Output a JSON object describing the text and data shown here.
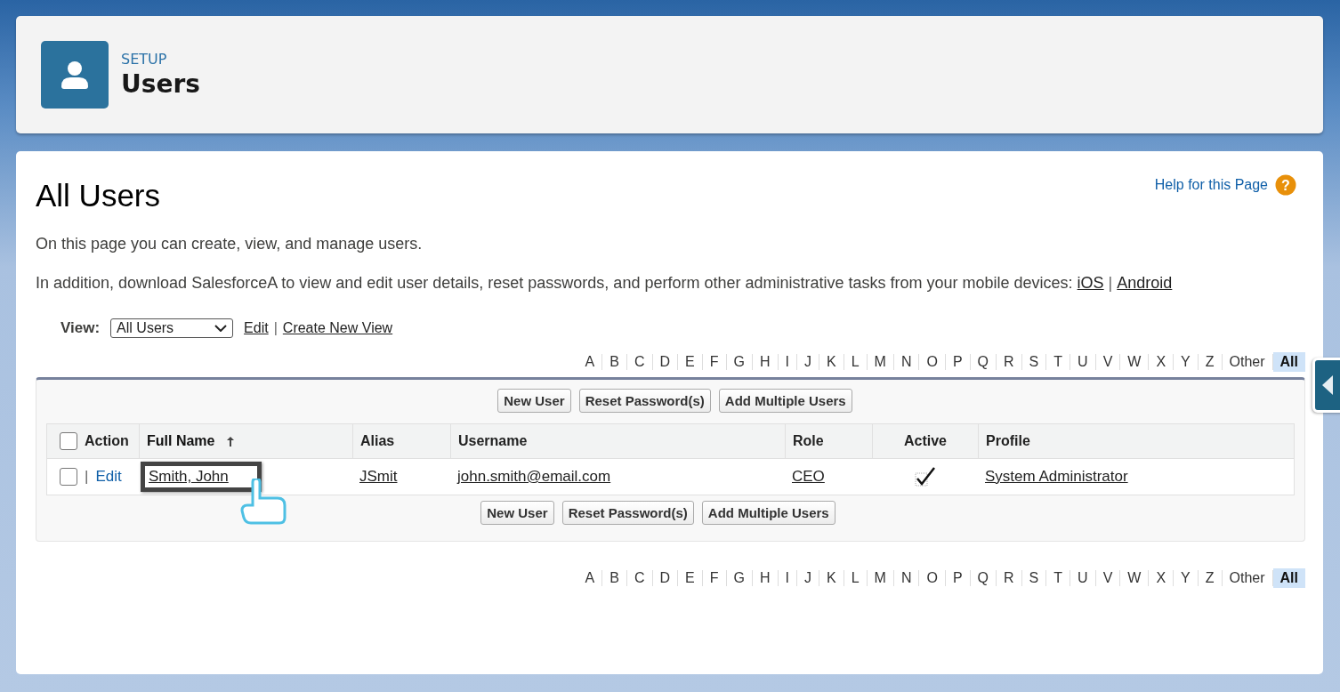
{
  "header": {
    "eyebrow": "SETUP",
    "title": "Users"
  },
  "page": {
    "title": "All Users",
    "help_link": "Help for this Page",
    "help_icon": "?",
    "link_separator": "|",
    "intro": "On this page you can create, view, and manage users.",
    "mobile_text": "In addition, download SalesforceA to view and edit user details, reset passwords, and perform other administrative tasks from your mobile devices:",
    "mobile_links": [
      "iOS",
      "Android"
    ]
  },
  "view": {
    "label": "View:",
    "value": "All Users",
    "links": [
      "Edit",
      "Create New View"
    ],
    "separator": "|"
  },
  "alphabet_top": [
    {
      "label": "A",
      "selected": false
    },
    {
      "label": "B",
      "selected": false
    },
    {
      "label": "C",
      "selected": false
    },
    {
      "label": "D",
      "selected": false
    },
    {
      "label": "E",
      "selected": false
    },
    {
      "label": "F",
      "selected": false
    },
    {
      "label": "G",
      "selected": false
    },
    {
      "label": "H",
      "selected": false
    },
    {
      "label": "I",
      "selected": false
    },
    {
      "label": "J",
      "selected": false
    },
    {
      "label": "K",
      "selected": false
    },
    {
      "label": "L",
      "selected": false
    },
    {
      "label": "M",
      "selected": false
    },
    {
      "label": "N",
      "selected": false
    },
    {
      "label": "O",
      "selected": false
    },
    {
      "label": "P",
      "selected": false
    },
    {
      "label": "Q",
      "selected": false
    },
    {
      "label": "R",
      "selected": false
    },
    {
      "label": "S",
      "selected": false
    },
    {
      "label": "T",
      "selected": false
    },
    {
      "label": "U",
      "selected": false
    },
    {
      "label": "V",
      "selected": false
    },
    {
      "label": "W",
      "selected": false
    },
    {
      "label": "X",
      "selected": false
    },
    {
      "label": "Y",
      "selected": false
    },
    {
      "label": "Z",
      "selected": false
    },
    {
      "label": "Other",
      "selected": false
    },
    {
      "label": "All",
      "selected": true
    }
  ],
  "buttons_top": [
    "New User",
    "Reset Password(s)",
    "Add Multiple Users"
  ],
  "table": {
    "select_all_checked": false,
    "columns": [
      {
        "label": "Action",
        "sorted": false
      },
      {
        "label": "Full Name",
        "sorted": true
      },
      {
        "label": "Alias",
        "sorted": false
      },
      {
        "label": "Username",
        "sorted": false
      },
      {
        "label": "Role",
        "sorted": false
      },
      {
        "label": "Active",
        "sorted": false
      },
      {
        "label": "Profile",
        "sorted": false
      }
    ],
    "rows": [
      {
        "checked": false,
        "separator": "|",
        "action": "Edit",
        "full_name": "Smith, John",
        "highlighted": true,
        "alias": "JSmit",
        "username": "john.smith@email.com",
        "role": "CEO",
        "active": true,
        "profile": "System Administrator"
      }
    ]
  },
  "buttons_bottom": [
    "New User",
    "Reset Password(s)",
    "Add Multiple Users"
  ],
  "alphabet_bottom": [
    {
      "label": "A",
      "selected": false
    },
    {
      "label": "B",
      "selected": false
    },
    {
      "label": "C",
      "selected": false
    },
    {
      "label": "D",
      "selected": false
    },
    {
      "label": "E",
      "selected": false
    },
    {
      "label": "F",
      "selected": false
    },
    {
      "label": "G",
      "selected": false
    },
    {
      "label": "H",
      "selected": false
    },
    {
      "label": "I",
      "selected": false
    },
    {
      "label": "J",
      "selected": false
    },
    {
      "label": "K",
      "selected": false
    },
    {
      "label": "L",
      "selected": false
    },
    {
      "label": "M",
      "selected": false
    },
    {
      "label": "N",
      "selected": false
    },
    {
      "label": "O",
      "selected": false
    },
    {
      "label": "P",
      "selected": false
    },
    {
      "label": "Q",
      "selected": false
    },
    {
      "label": "R",
      "selected": false
    },
    {
      "label": "S",
      "selected": false
    },
    {
      "label": "T",
      "selected": false
    },
    {
      "label": "U",
      "selected": false
    },
    {
      "label": "V",
      "selected": false
    },
    {
      "label": "W",
      "selected": false
    },
    {
      "label": "X",
      "selected": false
    },
    {
      "label": "Y",
      "selected": false
    },
    {
      "label": "Z",
      "selected": false
    },
    {
      "label": "Other",
      "selected": false
    },
    {
      "label": "All",
      "selected": true
    }
  ]
}
